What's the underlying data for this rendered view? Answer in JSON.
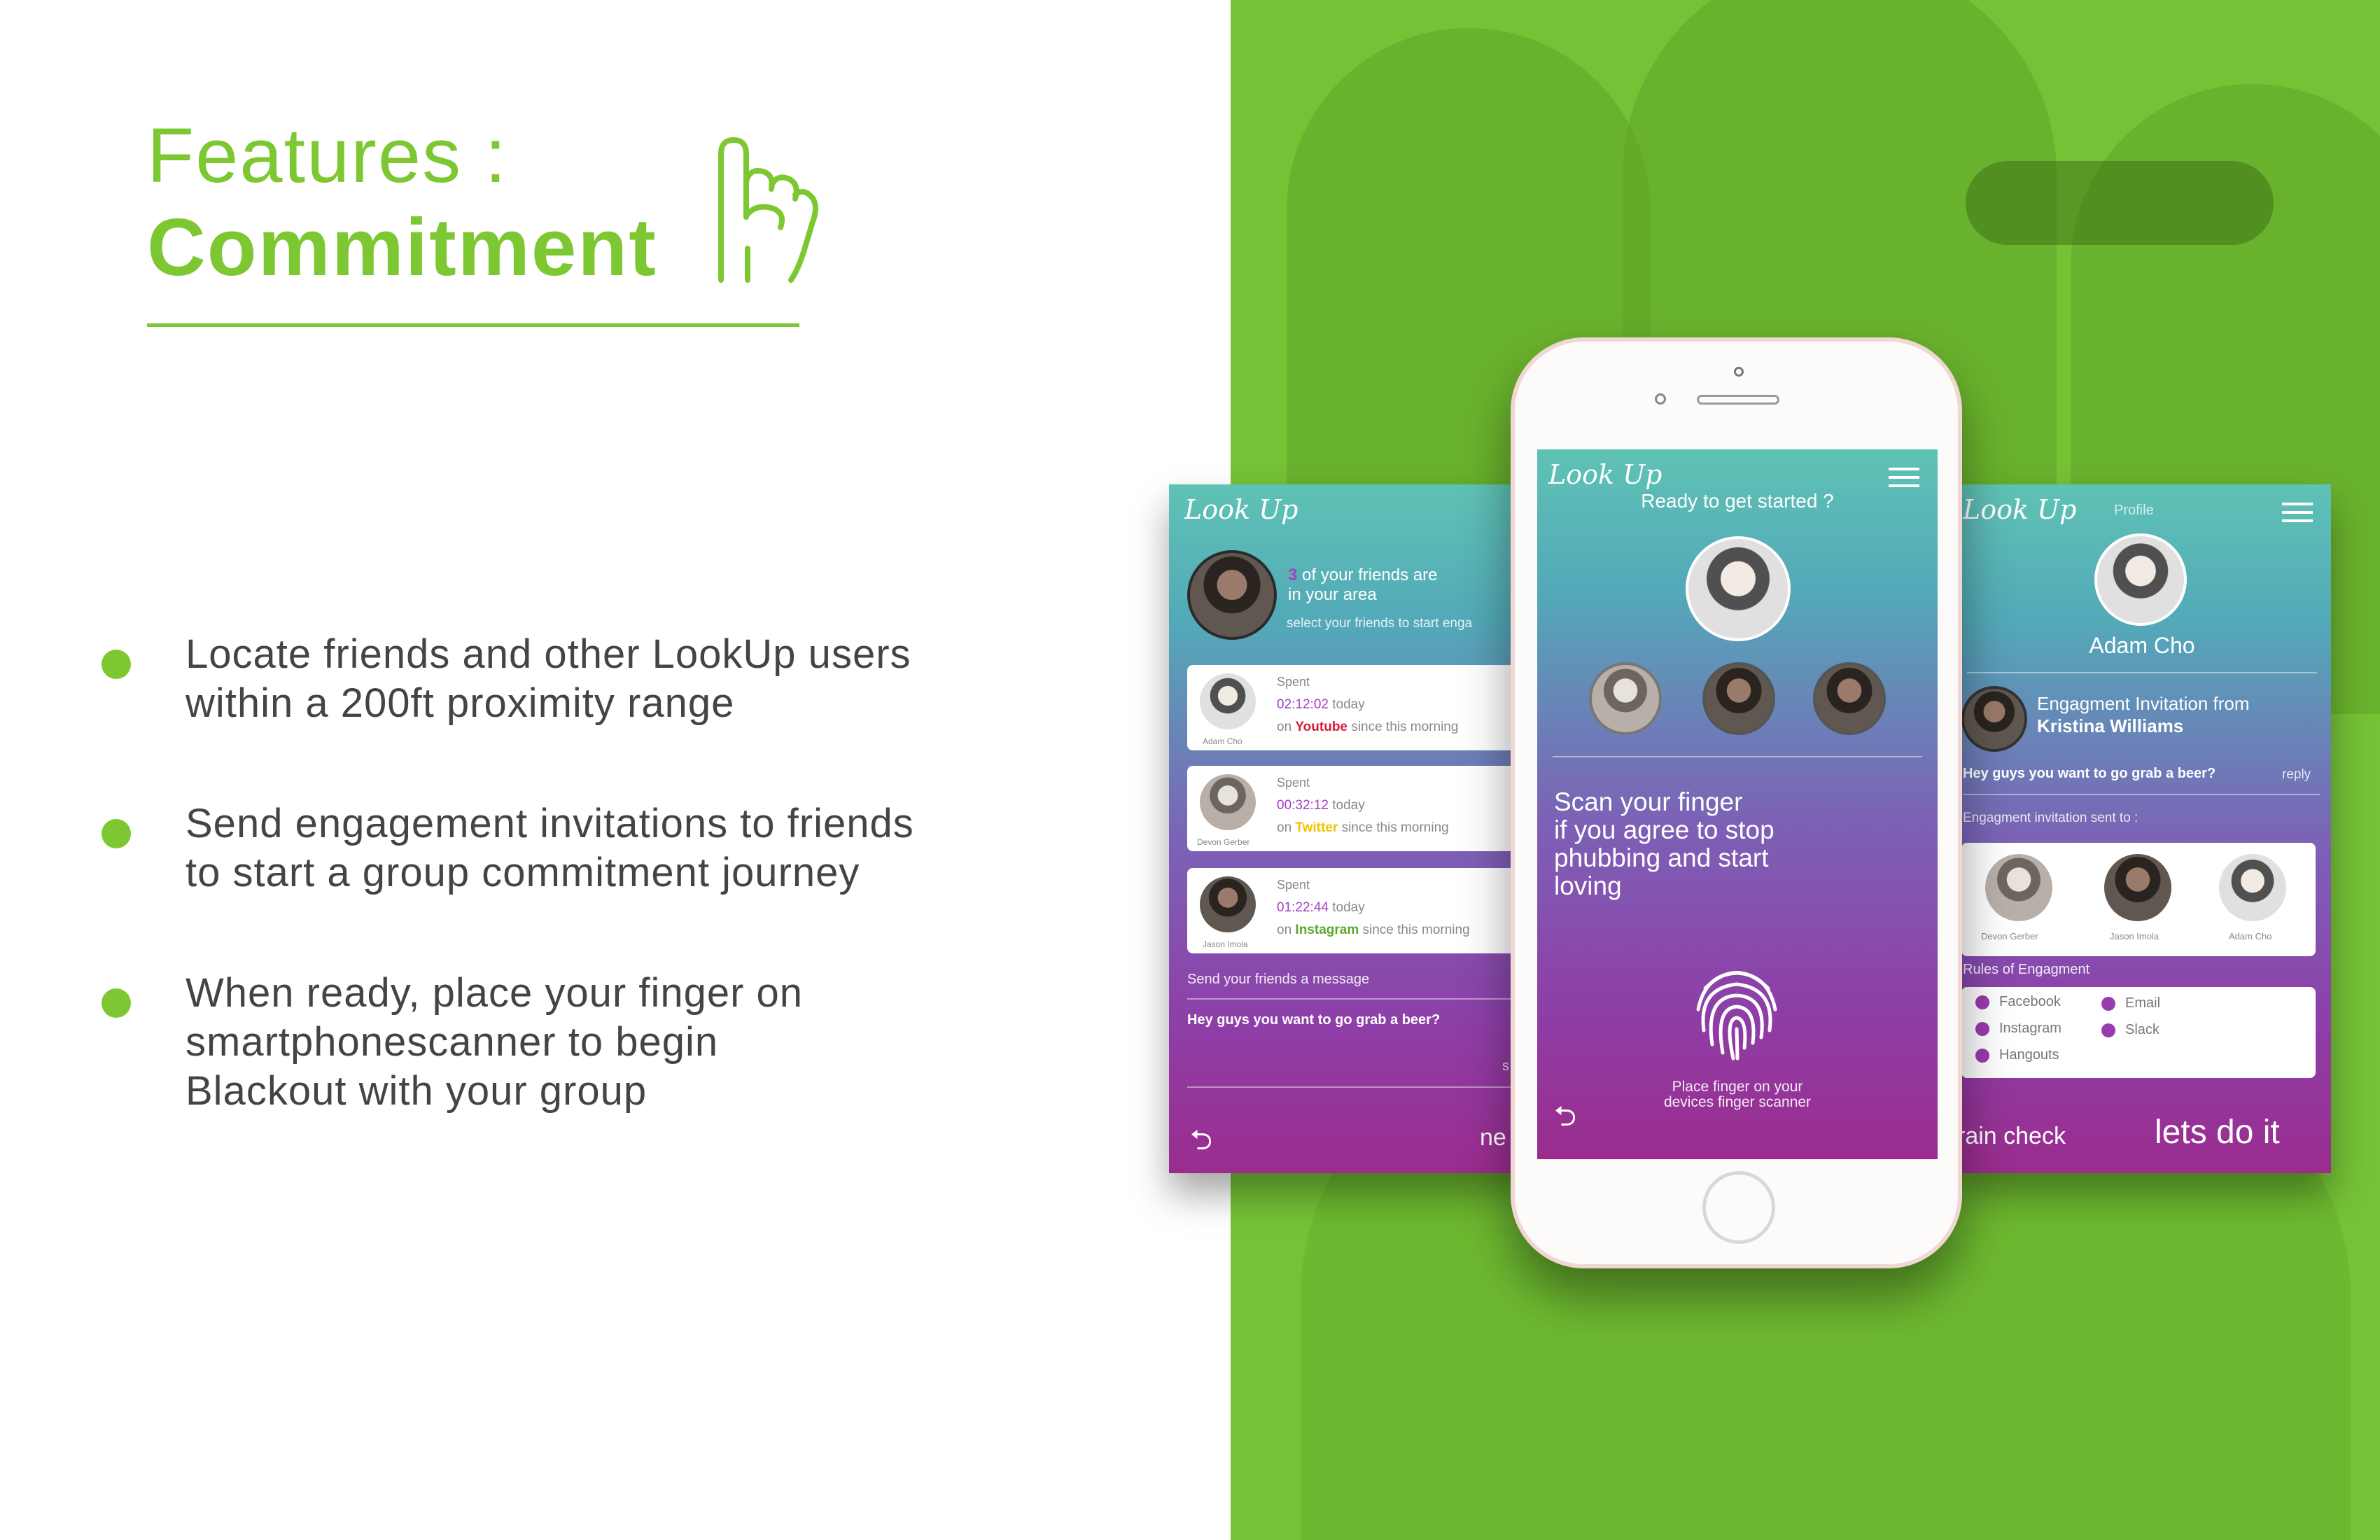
{
  "heading": {
    "line1": "Features :",
    "line2": "Commitment",
    "icon": "pinky-promise-hand-icon",
    "accent": "#7dc832"
  },
  "features": [
    {
      "text": "Locate friends and other LookUp users\nwithin a 200ft proximity range"
    },
    {
      "text": "Send engagement invitations to friends\nto start a group commitment journey"
    },
    {
      "text": "When ready, place your finger on\nsmartphonescanner to begin\nBlackout with your group"
    }
  ],
  "left_screen": {
    "logo": "Look Up",
    "friends_count": "3",
    "friends_text_1": "of your friends are",
    "friends_text_2": "in your area",
    "select_hint": "select your friends to start enga",
    "friends": [
      {
        "name": "Adam Cho",
        "spent": "Spent",
        "time": "02:12:02",
        "today": "today",
        "on": "on",
        "app": "Youtube",
        "since": "since this morning",
        "app_color": "#d81b3a"
      },
      {
        "name": "Devon Gerber",
        "spent": "Spent",
        "time": "00:32:12",
        "today": "today",
        "on": "on",
        "app": "Twitter",
        "since": "since this morning",
        "app_color": "#f2c300"
      },
      {
        "name": "Jason Imola",
        "spent": "Spent",
        "time": "01:22:44",
        "today": "today",
        "on": "on",
        "app": "Instagram",
        "since": "since this morning",
        "app_color": "#5aa82a"
      }
    ],
    "message_label": "Send your friends a message",
    "message_text": "Hey guys you want to go grab a beer?",
    "send_label": "s",
    "next_label": "ne"
  },
  "center_screen": {
    "logo": "Look Up",
    "title": "Ready to get started ?",
    "scan_text": "Scan your finger\nif you agree to stop\nphubbing and start\nloving",
    "finger_hint": "Place finger on your\ndevices finger scanner"
  },
  "right_screen": {
    "logo": "Look Up",
    "header": "Profile",
    "profile_name": "Adam Cho",
    "invitation_from_label": "Engagment Invitation from",
    "invitation_from_name": "Kristina Williams",
    "message": "Hey guys you want to go grab a beer?",
    "reply": "reply",
    "sent_to_label": "Engagment invitation sent to :",
    "recipients": [
      "Devon Gerber",
      "Jason Imola",
      "Adam Cho"
    ],
    "rules_label": "Rules of Engagment",
    "rules_col1": [
      "Facebook",
      "Instagram",
      "Hangouts"
    ],
    "rules_col2": [
      "Email",
      "Slack"
    ],
    "rain_check": "rain check",
    "lets_do_it": "lets do it"
  }
}
